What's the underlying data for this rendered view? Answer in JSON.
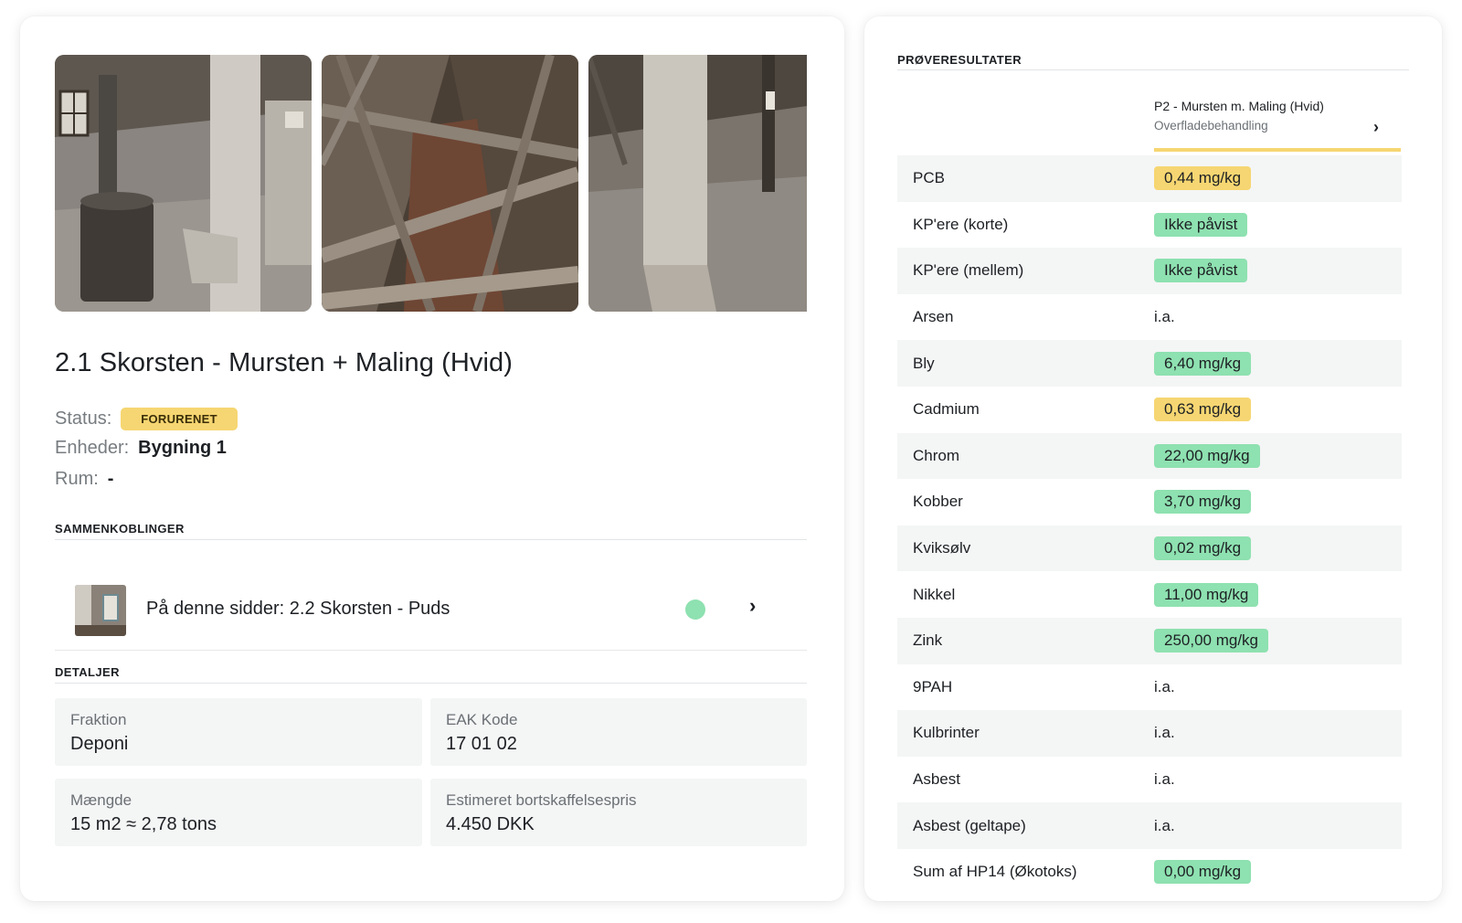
{
  "item": {
    "title": "2.1 Skorsten - Mursten + Maling (Hvid)",
    "status_label": "Status:",
    "status_value": "FORURENET",
    "enheder_label": "Enheder:",
    "enheder_value": "Bygning 1",
    "rum_label": "Rum:",
    "rum_value": "-"
  },
  "links": {
    "section_title": "SAMMENKOBLINGER",
    "items": [
      {
        "text": "På denne sidder: 2.2 Skorsten - Puds",
        "status_color": "#8ee1b0"
      }
    ]
  },
  "details": {
    "section_title": "DETALJER",
    "fields": [
      {
        "label": "Fraktion",
        "value": "Deponi"
      },
      {
        "label": "EAK Kode",
        "value": "17 01 02"
      },
      {
        "label": "Mængde",
        "value": "15 m2 ≈ 2,78 tons"
      },
      {
        "label": "Estimeret bortskaffelsespris",
        "value": "4.450 DKK"
      }
    ]
  },
  "results": {
    "section_title": "PRØVERESULTATER",
    "column": {
      "title": "P2 - Mursten m. Maling (Hvid)",
      "subtitle": "Overfladebehandling"
    },
    "rows": [
      {
        "name": "PCB",
        "value": "0,44 mg/kg",
        "level": "yellow"
      },
      {
        "name": "KP'ere (korte)",
        "value": "Ikke påvist",
        "level": "green"
      },
      {
        "name": "KP'ere (mellem)",
        "value": "Ikke påvist",
        "level": "green"
      },
      {
        "name": "Arsen",
        "value": "i.a.",
        "level": "none"
      },
      {
        "name": "Bly",
        "value": "6,40 mg/kg",
        "level": "green"
      },
      {
        "name": "Cadmium",
        "value": "0,63 mg/kg",
        "level": "yellow"
      },
      {
        "name": "Chrom",
        "value": "22,00 mg/kg",
        "level": "green"
      },
      {
        "name": "Kobber",
        "value": "3,70 mg/kg",
        "level": "green"
      },
      {
        "name": "Kviksølv",
        "value": "0,02 mg/kg",
        "level": "green"
      },
      {
        "name": "Nikkel",
        "value": "11,00 mg/kg",
        "level": "green"
      },
      {
        "name": "Zink",
        "value": "250,00 mg/kg",
        "level": "green"
      },
      {
        "name": "9PAH",
        "value": "i.a.",
        "level": "none"
      },
      {
        "name": "Kulbrinter",
        "value": "i.a.",
        "level": "none"
      },
      {
        "name": "Asbest",
        "value": "i.a.",
        "level": "none"
      },
      {
        "name": "Asbest (geltape)",
        "value": "i.a.",
        "level": "none"
      },
      {
        "name": "Sum af HP14 (Økotoks)",
        "value": "0,00 mg/kg",
        "level": "green"
      }
    ]
  },
  "colors": {
    "green": "#8ee1b0",
    "yellow": "#f6d672",
    "row_alt": "#f4f5f5"
  },
  "icons": {
    "chevron": "chevron-right-icon"
  }
}
